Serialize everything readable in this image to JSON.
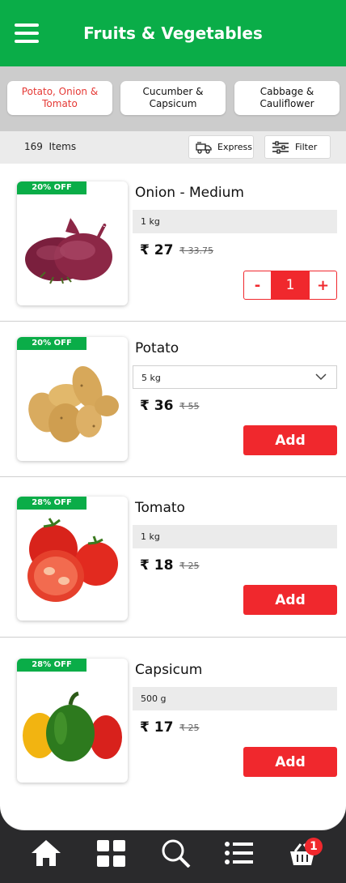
{
  "header": {
    "title": "Fruits & Vegetables"
  },
  "categories": [
    {
      "label": "Potato, Onion & Tomato",
      "active": true
    },
    {
      "label": "Cucumber & Capsicum",
      "active": false
    },
    {
      "label": "Cabbage & Cauliflower",
      "active": false
    }
  ],
  "toolbar": {
    "count": "169",
    "items_label": "Items",
    "express_label": "Express",
    "filter_label": "Filter"
  },
  "currency": "₹",
  "products": [
    {
      "name": "Onion - Medium",
      "discount": "20% OFF",
      "unit": "1 kg",
      "price": "27",
      "mrp": "33.75",
      "quantity": "1",
      "minus": "-",
      "plus": "+"
    },
    {
      "name": "Potato",
      "discount": "20% OFF",
      "unit": "5 kg",
      "price": "36",
      "mrp": "55",
      "add_label": "Add"
    },
    {
      "name": "Tomato",
      "discount": "28% OFF",
      "unit": "1 kg",
      "price": "18",
      "mrp": "25",
      "add_label": "Add"
    },
    {
      "name": "Capsicum",
      "discount": "28% OFF",
      "unit": "500 g",
      "price": "17",
      "mrp": "25",
      "add_label": "Add"
    }
  ],
  "nav": {
    "cart_count": "1"
  },
  "colors": {
    "brand_green": "#0aad48",
    "accent_red": "#f0282d",
    "nav_bg": "#2a2a2c"
  },
  "icons": [
    "hamburger-menu-icon",
    "express-delivery-icon",
    "filter-icon",
    "chevron-down-icon",
    "home-icon",
    "categories-icon",
    "search-icon",
    "list-icon",
    "cart-basket-icon"
  ]
}
